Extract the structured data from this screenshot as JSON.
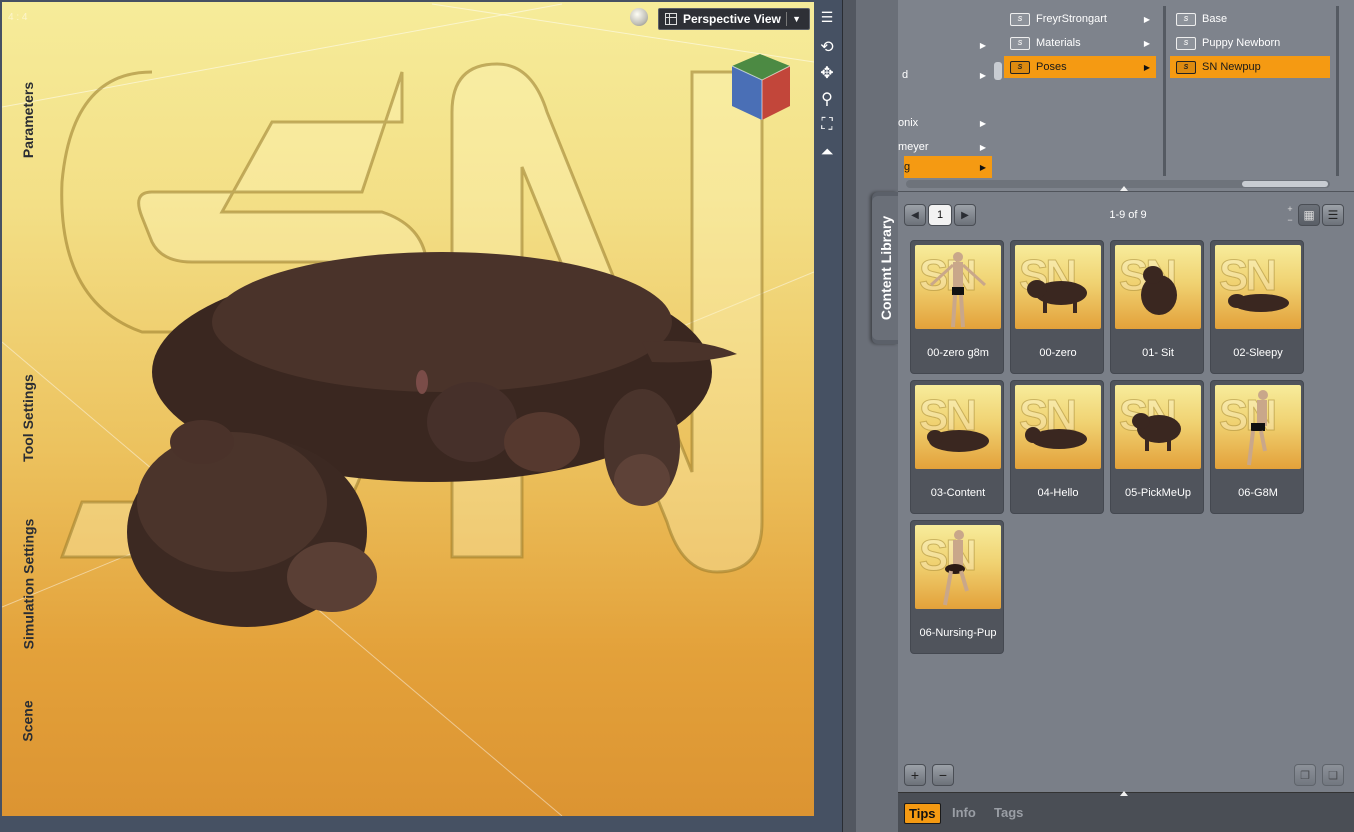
{
  "viewport": {
    "fraction_label": "4 : 4",
    "camera_label": "Perspective View"
  },
  "nav_icons": [
    "rotate-icon",
    "pan-icon",
    "zoom-icon",
    "frame-icon",
    "reset-icon"
  ],
  "side_tabs": {
    "parameters": "Parameters",
    "content_library": "Content Library",
    "tool_settings": "Tool Settings",
    "simulation_settings": "Simulation Settings",
    "scene": "Scene"
  },
  "browser": {
    "col_a": [
      {
        "label": "d",
        "selected": false
      },
      {
        "label": "onix",
        "selected": false
      },
      {
        "label": "meyer",
        "selected": false
      },
      {
        "label": "g",
        "selected": true
      }
    ],
    "col_b": [
      {
        "label": "FreyrStrongart",
        "selected": false
      },
      {
        "label": "Materials",
        "selected": false
      },
      {
        "label": "Poses",
        "selected": true
      }
    ],
    "col_c": [
      {
        "label": "Base",
        "selected": false
      },
      {
        "label": "Puppy Newborn",
        "selected": false
      },
      {
        "label": "SN Newpup",
        "selected": true
      }
    ]
  },
  "library": {
    "page": "1",
    "count_label": "1-9 of 9",
    "items": [
      {
        "label": "00-zero g8m"
      },
      {
        "label": "00-zero"
      },
      {
        "label": "01- Sit"
      },
      {
        "label": "02-Sleepy"
      },
      {
        "label": "03-Content"
      },
      {
        "label": "04-Hello"
      },
      {
        "label": "05-PickMeUp"
      },
      {
        "label": "06-G8M"
      },
      {
        "label": "06-Nursing-Pup"
      }
    ]
  },
  "bottom_buttons": {
    "add": "+",
    "remove": "−"
  },
  "bottom_tabs": {
    "tips": "Tips",
    "info": "Info",
    "tags": "Tags"
  },
  "colors": {
    "accent": "#f59a12",
    "viewport_bg_top": "#f6ec9a",
    "viewport_bg_bottom": "#dc9432"
  }
}
